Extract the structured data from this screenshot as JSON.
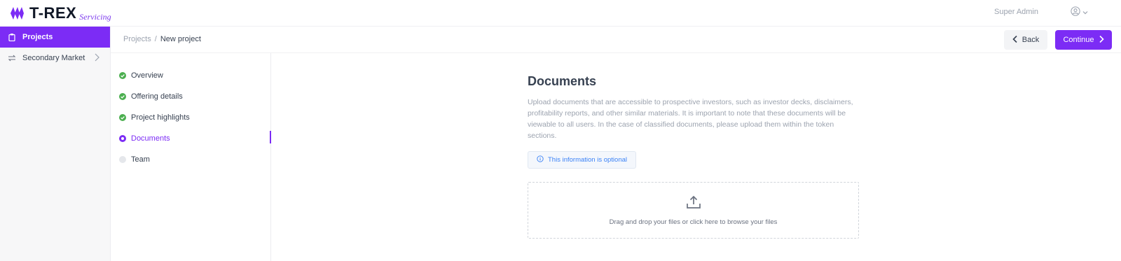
{
  "brand": {
    "name": "T-REX",
    "subtitle": "Servicing",
    "accent": "#7c2cf5"
  },
  "header": {
    "user_name": "Super Admin",
    "user_icon": "user-circle-icon"
  },
  "sidebar": {
    "items": [
      {
        "label": "Projects",
        "icon": "clipboard-icon",
        "active": true
      },
      {
        "label": "Secondary Market",
        "icon": "swap-arrows-icon",
        "active": false
      }
    ]
  },
  "breadcrumb": {
    "parent": "Projects",
    "separator": "/",
    "current": "New project"
  },
  "actions": {
    "back_label": "Back",
    "continue_label": "Continue"
  },
  "steps": [
    {
      "label": "Overview",
      "status": "done"
    },
    {
      "label": "Offering details",
      "status": "done"
    },
    {
      "label": "Project highlights",
      "status": "done"
    },
    {
      "label": "Documents",
      "status": "current"
    },
    {
      "label": "Team",
      "status": "pending"
    }
  ],
  "main": {
    "title": "Documents",
    "description": "Upload documents that are accessible to prospective investors, such as investor decks, disclaimers, profitability reports, and other similar materials. It is important to note that these documents will be viewable to all users. In the case of classified documents, please upload them within the token sections.",
    "info_note": "This information is optional",
    "dropzone_text": "Drag and drop your files or click here to browse your files"
  }
}
